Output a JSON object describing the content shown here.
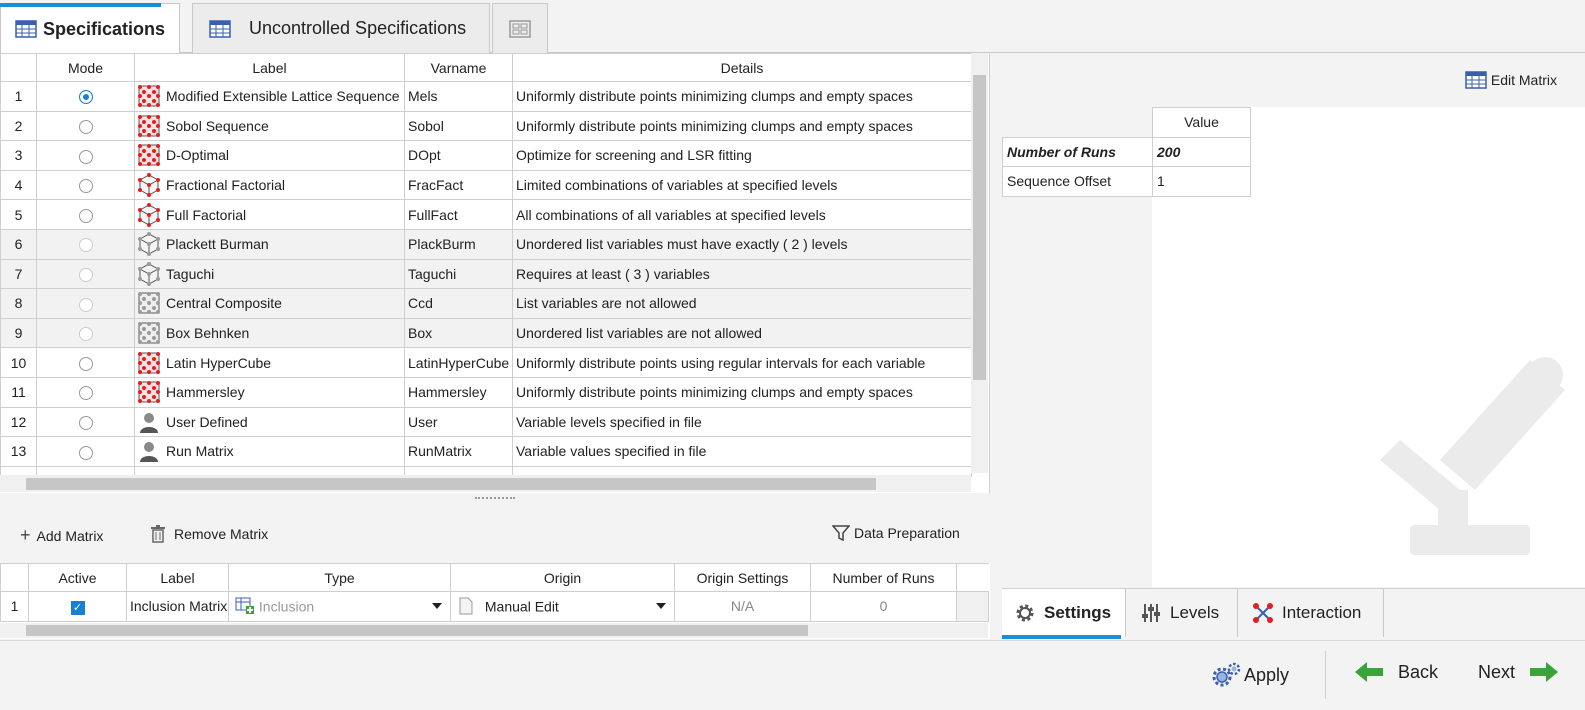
{
  "tabs": [
    {
      "label": "Specifications",
      "icon": "grid-icon",
      "active": true
    },
    {
      "label": "Uncontrolled Specifications",
      "icon": "grid-icon",
      "active": false
    },
    {
      "label": "",
      "icon": "layout-icon",
      "active": false
    }
  ],
  "main_table": {
    "columns": [
      "Mode",
      "Label",
      "Varname",
      "Details"
    ],
    "rows": [
      {
        "n": "1",
        "label": "Modified Extensible Lattice Sequence",
        "varname": "Mels",
        "details": "Uniformly distribute points minimizing clumps and empty spaces",
        "icon": "red-lattice-icon",
        "selected": true,
        "enabled": true
      },
      {
        "n": "2",
        "label": "Sobol Sequence",
        "varname": "Sobol",
        "details": "Uniformly distribute points minimizing clumps and empty spaces",
        "icon": "red-lattice-icon",
        "selected": false,
        "enabled": true
      },
      {
        "n": "3",
        "label": "D-Optimal",
        "varname": "DOpt",
        "details": "Optimize for screening and LSR fitting",
        "icon": "red-lattice-icon",
        "selected": false,
        "enabled": true
      },
      {
        "n": "4",
        "label": "Fractional Factorial",
        "varname": "FracFact",
        "details": "Limited combinations of variables at specified levels",
        "icon": "red-cube-icon",
        "selected": false,
        "enabled": true
      },
      {
        "n": "5",
        "label": "Full Factorial",
        "varname": "FullFact",
        "details": "All combinations of all variables at specified levels",
        "icon": "red-cube-icon",
        "selected": false,
        "enabled": true
      },
      {
        "n": "6",
        "label": "Plackett Burman",
        "varname": "PlackBurm",
        "details": "Unordered list variables must have exactly ( 2 ) levels",
        "icon": "gray-cube-icon",
        "selected": false,
        "enabled": false
      },
      {
        "n": "7",
        "label": "Taguchi",
        "varname": "Taguchi",
        "details": "Requires at least ( 3 ) variables",
        "icon": "gray-cube-icon",
        "selected": false,
        "enabled": false
      },
      {
        "n": "8",
        "label": "Central Composite",
        "varname": "Ccd",
        "details": "List variables are not allowed",
        "icon": "gray-lattice-icon",
        "selected": false,
        "enabled": false
      },
      {
        "n": "9",
        "label": "Box Behnken",
        "varname": "Box",
        "details": "Unordered list variables are not allowed",
        "icon": "gray-lattice-icon",
        "selected": false,
        "enabled": false
      },
      {
        "n": "10",
        "label": "Latin HyperCube",
        "varname": "LatinHyperCube",
        "details": "Uniformly distribute points using regular intervals for each variable",
        "icon": "red-lattice-icon",
        "selected": false,
        "enabled": true
      },
      {
        "n": "11",
        "label": "Hammersley",
        "varname": "Hammersley",
        "details": "Uniformly distribute points minimizing clumps and empty spaces",
        "icon": "red-lattice-icon",
        "selected": false,
        "enabled": true
      },
      {
        "n": "12",
        "label": "User Defined",
        "varname": "User",
        "details": "Variable levels specified in file",
        "icon": "user-icon",
        "selected": false,
        "enabled": true
      },
      {
        "n": "13",
        "label": "Run Matrix",
        "varname": "RunMatrix",
        "details": "Variable values specified in file",
        "icon": "user-icon",
        "selected": false,
        "enabled": true
      }
    ]
  },
  "toolbar": {
    "add_matrix": "Add Matrix",
    "remove_matrix": "Remove Matrix",
    "data_preparation": "Data Preparation"
  },
  "matrix_table": {
    "columns": [
      "Active",
      "Label",
      "Type",
      "Origin",
      "Origin Settings",
      "Number of Runs"
    ],
    "rows": [
      {
        "n": "1",
        "active": true,
        "label": "Inclusion Matrix",
        "type": "Inclusion",
        "origin": "Manual Edit",
        "origin_settings": "N/A",
        "runs": "0"
      }
    ]
  },
  "right_panel": {
    "edit_matrix": "Edit Matrix",
    "value_header": "Value",
    "params": [
      {
        "name": "Number of Runs",
        "value": "200",
        "emphasis": true
      },
      {
        "name": "Sequence Offset",
        "value": "1",
        "emphasis": false
      }
    ]
  },
  "bottom_tabs": [
    {
      "label": "Settings",
      "icon": "gear-icon",
      "active": true
    },
    {
      "label": "Levels",
      "icon": "sliders-icon",
      "active": false
    },
    {
      "label": "Interaction",
      "icon": "interaction-icon",
      "active": false
    }
  ],
  "footer": {
    "apply": "Apply",
    "back": "Back",
    "next": "Next"
  },
  "colors": {
    "accent": "#1a8fd6",
    "icon_red": "#e02020",
    "arrow_green": "#3aa43a"
  }
}
